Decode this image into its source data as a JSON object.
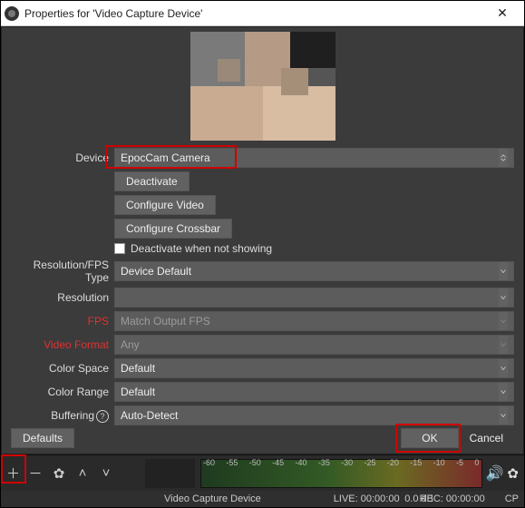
{
  "title": "Properties for 'Video Capture Device'",
  "labels": {
    "device": "Device",
    "deactivate": "Deactivate",
    "configure_video": "Configure Video",
    "configure_crossbar": "Configure Crossbar",
    "deactivate_not_showing": "Deactivate when not showing",
    "res_fps_type": "Resolution/FPS Type",
    "resolution": "Resolution",
    "fps": "FPS",
    "video_format": "Video Format",
    "color_space": "Color Space",
    "color_range": "Color Range",
    "buffering": "Buffering"
  },
  "values": {
    "device": "EpocCam Camera",
    "res_fps_type": "Device Default",
    "resolution": "",
    "fps": "Match Output FPS",
    "video_format": "Any",
    "color_space": "Default",
    "color_range": "Default",
    "buffering": "Auto-Detect"
  },
  "buttons": {
    "defaults": "Defaults",
    "ok": "OK",
    "cancel": "Cancel"
  },
  "meter": {
    "ticks": [
      "-60",
      "-55",
      "-50",
      "-45",
      "-40",
      "-35",
      "-30",
      "-25",
      "-20",
      "-15",
      "-10",
      "-5",
      "0"
    ]
  },
  "status": {
    "source_name": "Video Capture Device",
    "db": "0.0 dB",
    "live": "LIVE: 00:00:00",
    "rec": "REC: 00:00:00",
    "cpu": "CP"
  }
}
